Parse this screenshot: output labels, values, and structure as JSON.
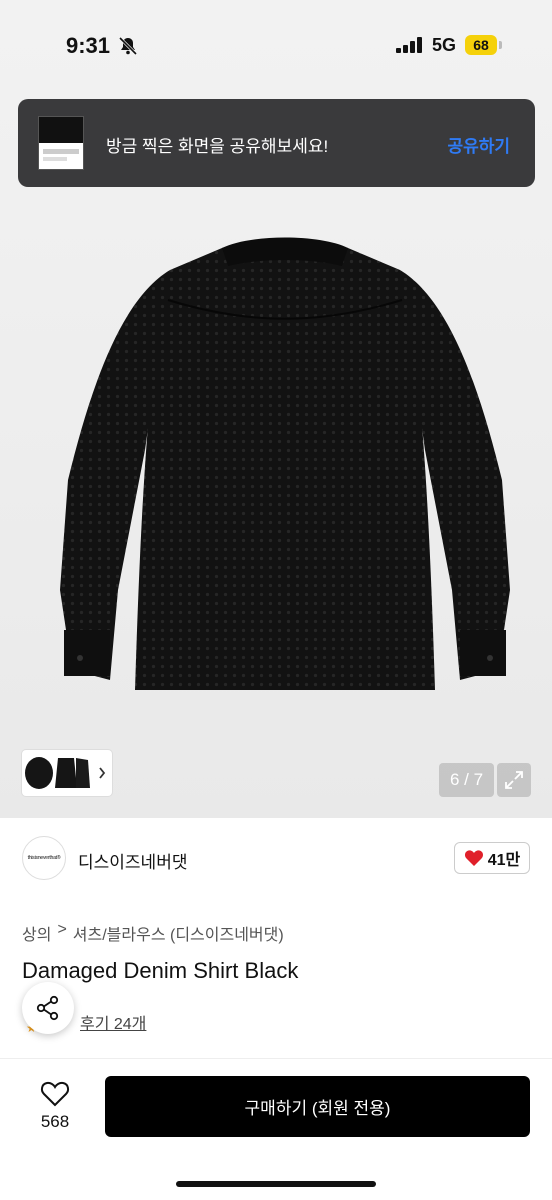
{
  "status_bar": {
    "time": "9:31",
    "network": "5G",
    "battery": "68"
  },
  "toast": {
    "message": "방금 찍은 화면을 공유해보세요!",
    "action": "공유하기"
  },
  "gallery": {
    "counter": "6 / 7"
  },
  "brand": {
    "logo_text": "thisisneverthat®",
    "name": "디스이즈네버댓",
    "likes": "41만"
  },
  "breadcrumb": {
    "category": "상의",
    "separator": ">",
    "subcategory": "셔츠/블라우스 (디스이즈네버댓)"
  },
  "product": {
    "name": "Damaged Denim Shirt Black",
    "reviews": "후기 24개"
  },
  "bottom_bar": {
    "favorite_count": "568",
    "buy_label": "구매하기 (회원 전용)"
  },
  "colors": {
    "accent_blue": "#2f7bf5",
    "heart_red": "#e0202a",
    "battery_yellow": "#f5d10a"
  }
}
